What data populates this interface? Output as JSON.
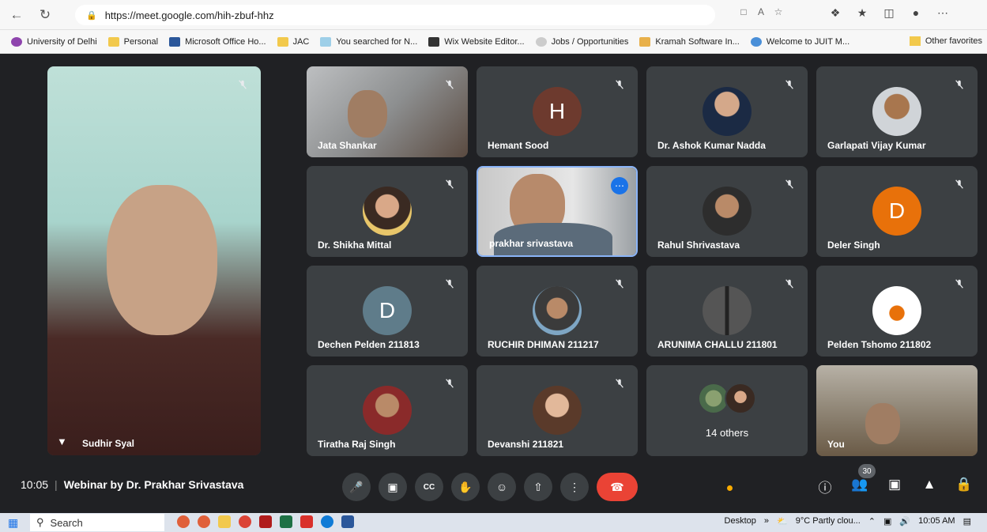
{
  "browser": {
    "url": "https://meet.google.com/hih-zbuf-hhz",
    "bookmarks": [
      {
        "label": "University of Delhi",
        "color": "#8e44ad"
      },
      {
        "label": "Personal",
        "color": "#f2c94c"
      },
      {
        "label": "Microsoft Office Ho...",
        "color": "#2b579a"
      },
      {
        "label": "JAC",
        "color": "#f2c94c"
      },
      {
        "label": "You searched for N...",
        "color": "#9ecfe8"
      },
      {
        "label": "Wix Website Editor...",
        "color": "#333333"
      },
      {
        "label": "Jobs / Opportunities",
        "color": "#cccccc"
      },
      {
        "label": "Kramah Software In...",
        "color": "#e8b04a"
      },
      {
        "label": "Welcome to JUIT M...",
        "color": "#4a8fd8"
      }
    ],
    "other_favorites": "Other favorites"
  },
  "tiles": {
    "main": {
      "name": "Sudhir Syal"
    },
    "t1": {
      "name": "Jata Shankar"
    },
    "t2": {
      "name": "Hemant Sood",
      "initial": "H",
      "color": "#6d3a2e"
    },
    "t3": {
      "name": "Dr. Ashok Kumar Nadda"
    },
    "t4": {
      "name": "Garlapati Vijay Kumar"
    },
    "t5": {
      "name": "Dr. Shikha Mittal"
    },
    "t6": {
      "name": "prakhar srivastava"
    },
    "t7": {
      "name": "Rahul Shrivastava"
    },
    "t8": {
      "name": "Deler Singh",
      "initial": "D",
      "color": "#e8710a"
    },
    "t9": {
      "name": "Dechen Pelden 211813",
      "initial": "D",
      "color": "#5f7c8a"
    },
    "t10": {
      "name": "RUCHIR DHIMAN 211217"
    },
    "t11": {
      "name": "ARUNIMA CHALLU 211801"
    },
    "t12": {
      "name": "Pelden Tshomo 211802"
    },
    "t13": {
      "name": "Tiratha Raj Singh"
    },
    "t14": {
      "name": "Devanshi 211821"
    },
    "t15": {
      "name": "14 others"
    },
    "t16": {
      "name": "You"
    }
  },
  "bottom": {
    "time": "10:05",
    "title": "Webinar by Dr. Prakhar Srivastava",
    "participants_count": "30"
  },
  "taskbar": {
    "search": "Search",
    "desktop": "Desktop",
    "weather": "9°C  Partly clou...",
    "clock": "10:05 AM"
  }
}
